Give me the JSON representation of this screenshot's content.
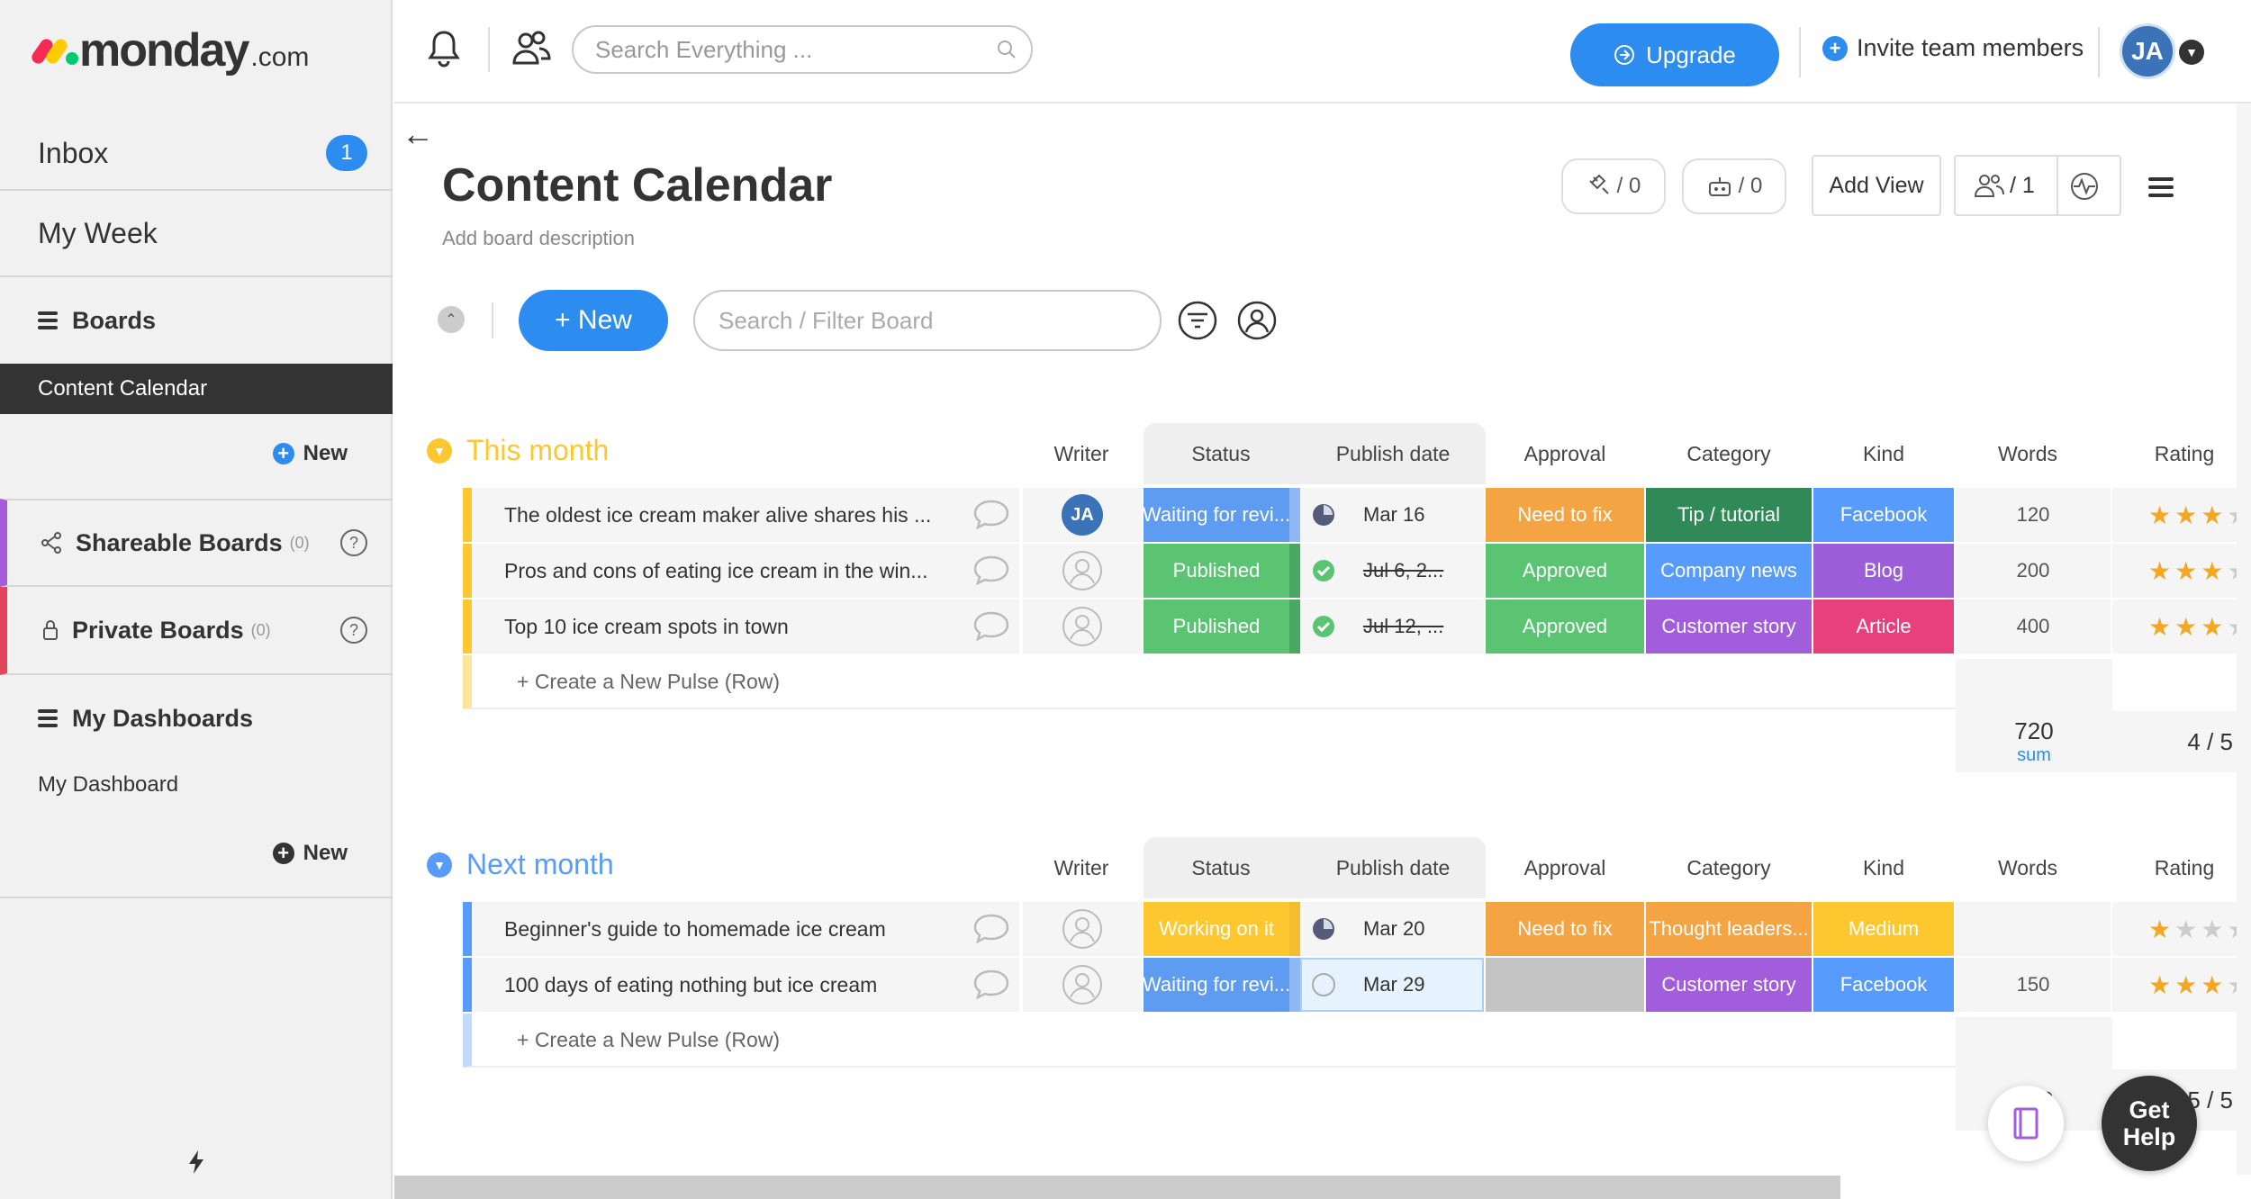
{
  "app": {
    "brand": "monday",
    "tld": ".com"
  },
  "sidebar": {
    "inbox_label": "Inbox",
    "inbox_count": "1",
    "myweek_label": "My Week",
    "boards_label": "Boards",
    "active_board": "Content Calendar",
    "new_label": "New",
    "shareable_label": "Shareable Boards",
    "shareable_count": "(0)",
    "private_label": "Private Boards",
    "private_count": "(0)",
    "dashboards_label": "My Dashboards",
    "dashboard_item": "My Dashboard",
    "new_label2": "New"
  },
  "topbar": {
    "search_placeholder": "Search Everything ...",
    "upgrade_label": "Upgrade",
    "invite_label": "Invite team members",
    "avatar_initials": "JA"
  },
  "board": {
    "back_arrow": "←",
    "title": "Content Calendar",
    "description": "Add board description",
    "integrations_count": "/ 0",
    "automations_count": "/ 0",
    "add_view_label": "Add View",
    "members_count": "/ 1",
    "new_button": "+ New",
    "filter_placeholder": "Search / Filter Board"
  },
  "columns": [
    "Writer",
    "Status",
    "Publish date",
    "Approval",
    "Category",
    "Kind",
    "Words",
    "Rating"
  ],
  "groups": [
    {
      "title": "This month",
      "color": "#fdc72f",
      "rows": [
        {
          "name": "The oldest ice cream maker alive shares his ...",
          "writer": "JA",
          "status": "Waiting for revi...",
          "status_color": "#5e9cf2",
          "date_icon": "clock",
          "date": "Mar 16",
          "approval": "Need to fix",
          "approval_color": "#f5a443",
          "category": "Tip / tutorial",
          "category_color": "#2f8a58",
          "kind": "Facebook",
          "kind_color": "#579bfc",
          "words": "120",
          "rating": 3
        },
        {
          "name": "Pros and cons of eating ice cream in the win...",
          "writer": "",
          "status": "Published",
          "status_color": "#5bc473",
          "date_icon": "check",
          "date": "Jul 6, 2...",
          "approval": "Approved",
          "approval_color": "#5bc473",
          "category": "Company news",
          "category_color": "#579bfc",
          "kind": "Blog",
          "kind_color": "#9c5ed8",
          "words": "200",
          "rating": 3
        },
        {
          "name": "Top 10 ice cream spots in town",
          "writer": "",
          "status": "Published",
          "status_color": "#5bc473",
          "date_icon": "check",
          "date": "Jul 12, ...",
          "approval": "Approved",
          "approval_color": "#5bc473",
          "category": "Customer story",
          "category_color": "#a25ddc",
          "kind": "Article",
          "kind_color": "#e8407a",
          "words": "400",
          "rating": 3
        }
      ],
      "create_label": "+ Create a New Pulse (Row)",
      "sum_value": "720",
      "sum_label": "sum",
      "rating_summary": "4 / 5"
    },
    {
      "title": "Next month",
      "color": "#579bfc",
      "rows": [
        {
          "name": "Beginner's guide to homemade ice cream",
          "writer": "",
          "status": "Working on it",
          "status_color": "#fdc72f",
          "date_icon": "clock",
          "date": "Mar 20",
          "approval": "Need to fix",
          "approval_color": "#f5a443",
          "category": "Thought leaders...",
          "category_color": "#f5a443",
          "kind": "Medium",
          "kind_color": "#fdc72f",
          "words": "",
          "rating": 1
        },
        {
          "name": "100 days of eating nothing but ice cream",
          "writer": "",
          "status": "Waiting for revi...",
          "status_color": "#5e9cf2",
          "date_icon": "empty",
          "date": "Mar 29",
          "approval": "",
          "approval_color": "#c4c4c4",
          "category": "Customer story",
          "category_color": "#a25ddc",
          "kind": "Facebook",
          "kind_color": "#579bfc",
          "words": "150",
          "rating": 3
        }
      ],
      "create_label": "+ Create a New Pulse (Row)",
      "sum_value": "150",
      "rating_summary": "2.5 / 5"
    }
  ],
  "help": {
    "line1": "Get",
    "line2": "Help"
  },
  "icons": [
    "bell-icon",
    "people-icon",
    "search-icon",
    "lightning-icon",
    "book-icon",
    "filter-icon",
    "person-filter-icon",
    "activity-icon",
    "menu-icon"
  ]
}
